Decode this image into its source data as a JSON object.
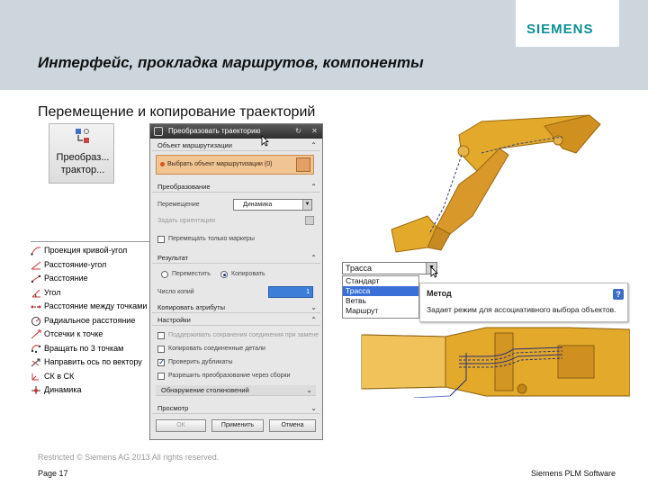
{
  "header": {
    "title": "Интерфейс, прокладка маршрутов, компоненты",
    "logo": "SIEMENS",
    "subtitle": "Перемещение и копирование траекторий"
  },
  "ribbon": {
    "label_line1": "Преобраз...",
    "label_line2": "трактор..."
  },
  "menu": {
    "items": [
      "Проекция кривой-угол",
      "Расстояние-угол",
      "Расстояние",
      "Угол",
      "Расстояние между точками",
      "Радиальное расстояние",
      "Отсечки к точке",
      "Вращать по 3 точкам",
      "Направить ось по вектору",
      "СК в СК",
      "Динамика"
    ]
  },
  "dialog": {
    "title": "Преобразовать траекторию",
    "sections": {
      "route_object": "Объект маршрутизации",
      "transform": "Преобразование",
      "results": "Результат",
      "copy_attributes": "Копировать атрибуты",
      "settings": "Настройки",
      "preview": "Просмотр"
    },
    "select_object_label": "Выбрать объект маршрутизации (0)",
    "movement_label": "Перемещение",
    "movement_value": "Динамика",
    "set_orientation": "Задать ориентацию",
    "move_markers_only": "Перемещать только маркеры",
    "radio_move": "Переместить",
    "radio_copy": "Копировать",
    "copies_label": "Число копий",
    "copies_value": "1",
    "settings_items": [
      "Поддерживать сохранения соединения при замене",
      "Копировать соединенные детали",
      "Проверить дубликаты",
      "Разрешить преобразование через сборки"
    ],
    "settings_checked": [
      false,
      false,
      true,
      false
    ],
    "detect_collisions": "Обнаружение столкновений",
    "buttons": {
      "ok": "ОК",
      "apply": "Применить",
      "cancel": "Отмена"
    }
  },
  "route_dropdown": {
    "value": "Трасса",
    "options": [
      "Стандарт",
      "Трасса",
      "Ветвь",
      "Маршрут"
    ],
    "selected_index": 1
  },
  "tooltip": {
    "title": "Метод",
    "text": "Задает режим для ассоциативного выбора объектов."
  },
  "footer": {
    "restricted": "Restricted © Siemens AG 2013 All rights reserved.",
    "page": "Page 17",
    "company": "Siemens PLM Software"
  },
  "colors": {
    "header_bg": "#cdd6dd",
    "logo_teal": "#0b8f95",
    "model_yellow": "#e3a92a",
    "highlight_blue": "#3a6fd8",
    "object_row_orange": "#f1c493"
  }
}
